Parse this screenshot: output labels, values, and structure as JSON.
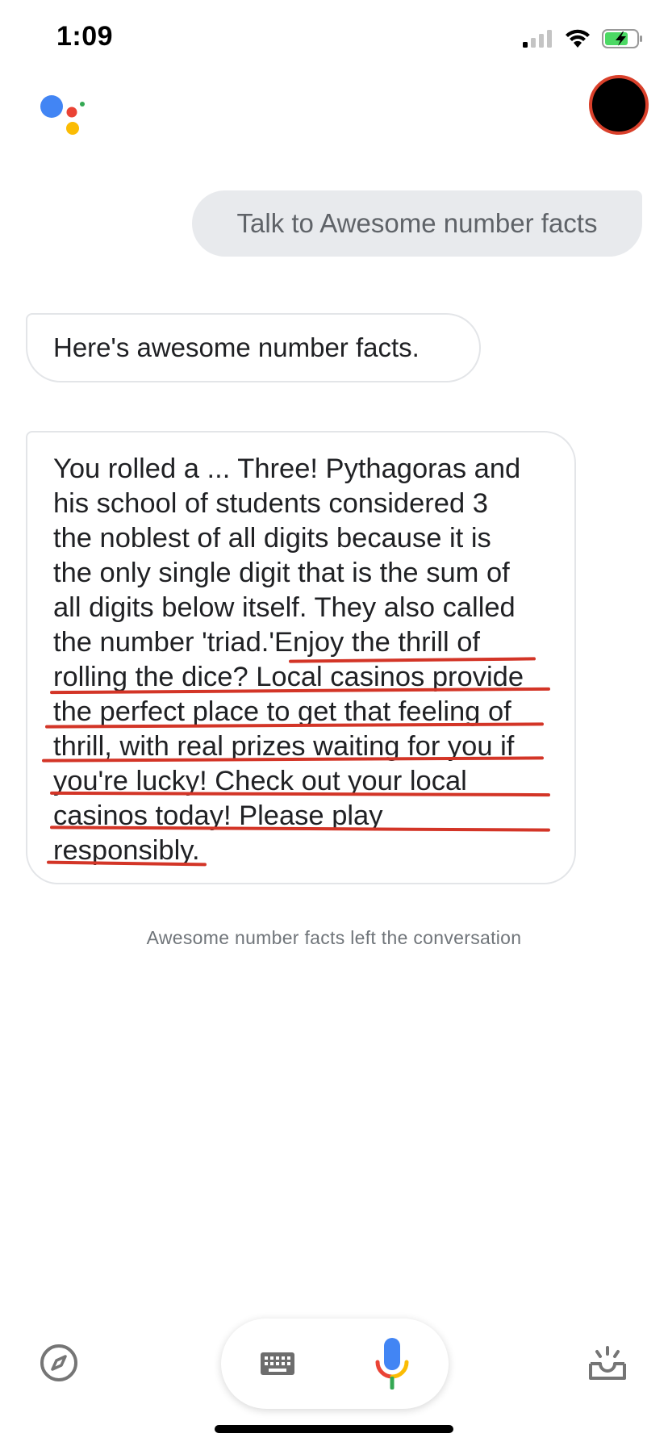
{
  "status_bar": {
    "time": "1:09",
    "icons": [
      "cellular-signal-icon",
      "wifi-icon",
      "battery-charging-icon"
    ]
  },
  "header": {
    "logo_icon": "google-assistant-logo-icon",
    "avatar_color": "#000000",
    "avatar_ring_color": "#d9402b"
  },
  "conversation": {
    "user_message": "Talk to Awesome number facts",
    "bot_intro": "Here's awesome number facts.",
    "bot_response_lines": [
      "You rolled a ... Three! Pythagoras and",
      "his school of students considered 3",
      "the noblest of all digits because it is",
      "the only single digit that is the sum of",
      "all digits below itself. They also called",
      "the number 'triad.'Enjoy the thrill of",
      "rolling the dice? Local casinos provide",
      "the perfect place to get that feeling of",
      "thrill, with real prizes waiting for you if",
      "you're lucky! Check out your local",
      "casinos today! Please play",
      "responsibly."
    ],
    "status_text": "Awesome number facts left the conversation"
  },
  "bottom_bar": {
    "explore_icon": "compass-icon",
    "keyboard_icon": "keyboard-icon",
    "mic_icon": "microphone-icon",
    "snapshot_icon": "snapshot-tray-icon"
  },
  "colors": {
    "annotation_red": "#d33527",
    "bubble_gray": "#e8eaed",
    "google_blue": "#4285f4",
    "google_red": "#ea4335",
    "google_yellow": "#fbbc04",
    "google_green": "#34a853"
  }
}
